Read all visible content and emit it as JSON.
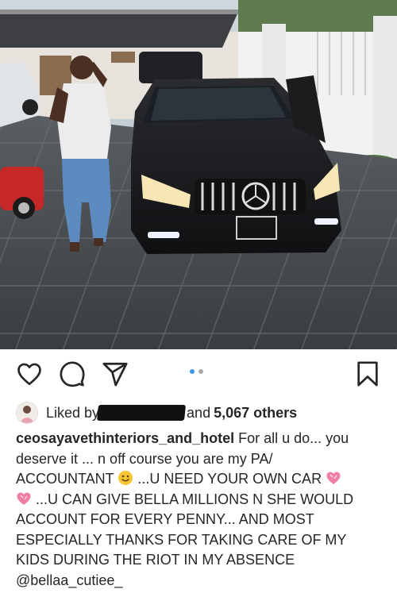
{
  "post": {
    "username": "ceosayavethinteriors_and_hotel",
    "likes": {
      "liked_by_prefix": "Liked by",
      "and_prefix": "and",
      "count_text": "5,067 others"
    },
    "caption_lines": [
      "For all u do... you",
      "deserve it ... n off course you are my PA/",
      "ACCOUNTANT",
      "...U NEED YOUR OWN CAR",
      "...U CAN GIVE BELLA MILLIONS N SHE WOULD",
      "ACCOUNT FOR EVERY PENNY... AND MOST",
      "ESPECIALLY THANKS FOR TAKING CARE OF MY",
      "KIDS DURING THE RIOT IN MY ABSENCE",
      "@bellaa_cutiee_"
    ],
    "carousel": {
      "total": 2,
      "active_index": 0
    }
  },
  "icons": {
    "like": "heart-icon",
    "comment": "comment-icon",
    "share": "send-icon",
    "save": "bookmark-icon",
    "emoji_smile": "smiling-face-emoji",
    "emoji_heart": "pink-heart-emoji"
  },
  "colors": {
    "text": "#262626",
    "carousel_active": "#3897f0",
    "carousel_inactive": "#a8a8a8"
  }
}
